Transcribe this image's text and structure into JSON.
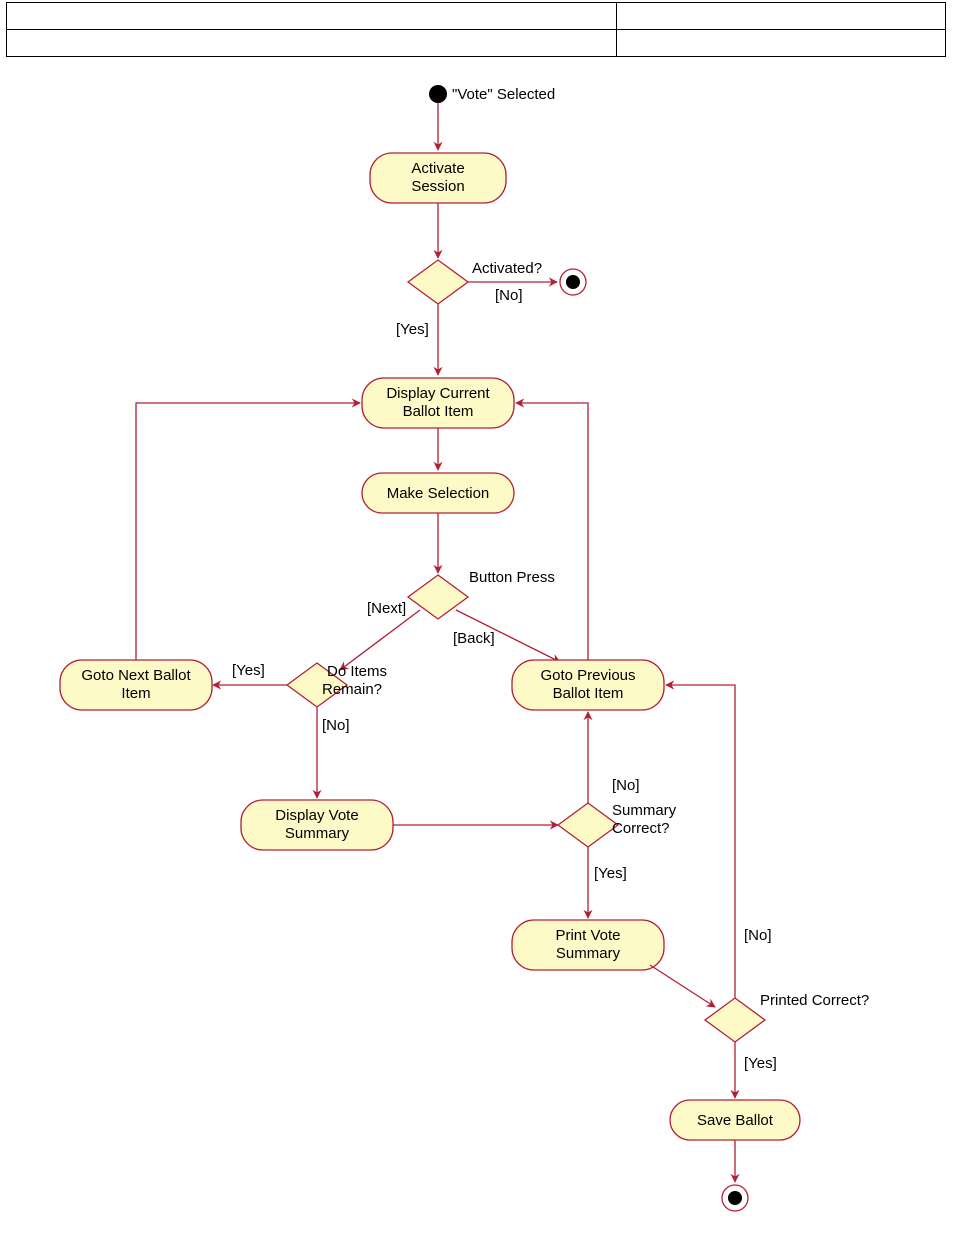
{
  "header": {
    "row1_left": "",
    "row1_right": "",
    "row2_left": "",
    "row2_right": ""
  },
  "nodes": {
    "start_label": "\"Vote\" Selected",
    "activate_session_l1": "Activate",
    "activate_session_l2": "Session",
    "decision_activated": "Activated?",
    "guard_no": "[No]",
    "guard_yes": "[Yes]",
    "display_current_l1": "Display Current",
    "display_current_l2": "Ballot Item",
    "make_selection": "Make Selection",
    "decision_button": "Button Press",
    "guard_next": "[Next]",
    "guard_back": "[Back]",
    "decision_items_l1": "Do Items",
    "decision_items_l2": "Remain?",
    "guard_yes2": "[Yes]",
    "guard_no2": "[No]",
    "goto_next_l1": "Goto Next Ballot",
    "goto_next_l2": "Item",
    "goto_prev_l1": "Goto Previous",
    "goto_prev_l2": "Ballot Item",
    "display_vote_l1": "Display Vote",
    "display_vote_l2": "Summary",
    "decision_summary_l1": "Summary",
    "decision_summary_l2": "Correct?",
    "guard_no3": "[No]",
    "guard_yes3": "[Yes]",
    "print_vote_l1": "Print Vote",
    "print_vote_l2": "Summary",
    "decision_printed": "Printed Correct?",
    "guard_no4": "[No]",
    "guard_yes4": "[Yes]",
    "save_ballot": "Save Ballot"
  }
}
